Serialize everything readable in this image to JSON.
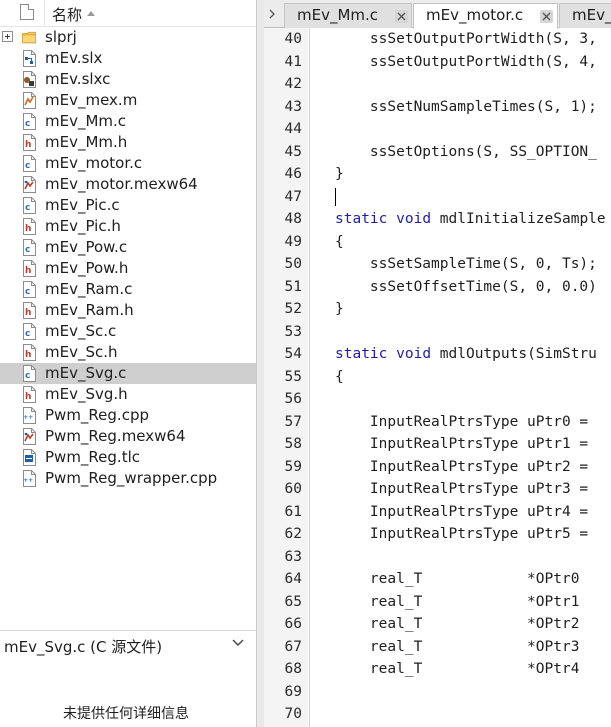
{
  "explorer": {
    "column_name": "名称",
    "files": [
      {
        "name": "slprj",
        "icon": "folder-icon",
        "expandable": true
      },
      {
        "name": "mEv.slx",
        "icon": "simulink-model-icon"
      },
      {
        "name": "mEv.slxc",
        "icon": "simulink-cache-icon"
      },
      {
        "name": "mEv_mex.m",
        "icon": "matlab-script-icon"
      },
      {
        "name": "mEv_Mm.c",
        "icon": "c-file-icon"
      },
      {
        "name": "mEv_Mm.h",
        "icon": "h-file-icon"
      },
      {
        "name": "mEv_motor.c",
        "icon": "c-file-icon"
      },
      {
        "name": "mEv_motor.mexw64",
        "icon": "mex-file-icon"
      },
      {
        "name": "mEv_Pic.c",
        "icon": "c-file-icon"
      },
      {
        "name": "mEv_Pic.h",
        "icon": "h-file-icon"
      },
      {
        "name": "mEv_Pow.c",
        "icon": "c-file-icon"
      },
      {
        "name": "mEv_Pow.h",
        "icon": "h-file-icon"
      },
      {
        "name": "mEv_Ram.c",
        "icon": "c-file-icon"
      },
      {
        "name": "mEv_Ram.h",
        "icon": "h-file-icon"
      },
      {
        "name": "mEv_Sc.c",
        "icon": "c-file-icon"
      },
      {
        "name": "mEv_Sc.h",
        "icon": "h-file-icon"
      },
      {
        "name": "mEv_Svg.c",
        "icon": "c-file-icon",
        "selected": true
      },
      {
        "name": "mEv_Svg.h",
        "icon": "h-file-icon"
      },
      {
        "name": "Pwm_Reg.cpp",
        "icon": "cpp-file-icon"
      },
      {
        "name": "Pwm_Reg.mexw64",
        "icon": "mex-file-icon"
      },
      {
        "name": "Pwm_Reg.tlc",
        "icon": "tlc-file-icon"
      },
      {
        "name": "Pwm_Reg_wrapper.cpp",
        "icon": "cpp-file-icon"
      }
    ]
  },
  "details": {
    "title": "mEv_Svg.c  (C 源文件)",
    "message": "未提供任何详细信息"
  },
  "tabs": [
    {
      "label": "mEv_Mm.c",
      "active": false
    },
    {
      "label": "mEv_motor.c",
      "active": true
    },
    {
      "label": "mEv_S",
      "active": false
    }
  ],
  "code": {
    "lines": [
      {
        "n": "40",
        "text": "    ssSetOutputPortWidth(S, 3,"
      },
      {
        "n": "41",
        "text": "    ssSetOutputPortWidth(S, 4,"
      },
      {
        "n": "42",
        "text": ""
      },
      {
        "n": "43",
        "text": "    ssSetNumSampleTimes(S, 1);"
      },
      {
        "n": "44",
        "text": ""
      },
      {
        "n": "45",
        "text": "    ssSetOptions(S, SS_OPTION_"
      },
      {
        "n": "46",
        "text": "}"
      },
      {
        "n": "47",
        "text": ""
      },
      {
        "n": "48",
        "text": "static void mdlInitializeSample"
      },
      {
        "n": "49",
        "text": "{"
      },
      {
        "n": "50",
        "text": "    ssSetSampleTime(S, 0, Ts);"
      },
      {
        "n": "51",
        "text": "    ssSetOffsetTime(S, 0, 0.0)"
      },
      {
        "n": "52",
        "text": "}"
      },
      {
        "n": "53",
        "text": ""
      },
      {
        "n": "54",
        "text": "static void mdlOutputs(SimStru"
      },
      {
        "n": "55",
        "text": "{"
      },
      {
        "n": "56",
        "text": ""
      },
      {
        "n": "57",
        "text": "    InputRealPtrsType uPtr0 ="
      },
      {
        "n": "58",
        "text": "    InputRealPtrsType uPtr1 ="
      },
      {
        "n": "59",
        "text": "    InputRealPtrsType uPtr2 ="
      },
      {
        "n": "60",
        "text": "    InputRealPtrsType uPtr3 ="
      },
      {
        "n": "61",
        "text": "    InputRealPtrsType uPtr4 ="
      },
      {
        "n": "62",
        "text": "    InputRealPtrsType uPtr5 ="
      },
      {
        "n": "63",
        "text": ""
      },
      {
        "n": "64",
        "text": "    real_T            *OPtr0"
      },
      {
        "n": "65",
        "text": "    real_T            *OPtr1"
      },
      {
        "n": "66",
        "text": "    real_T            *OPtr2"
      },
      {
        "n": "67",
        "text": "    real_T            *OPtr3"
      },
      {
        "n": "68",
        "text": "    real_T            *OPtr4"
      },
      {
        "n": "69",
        "text": ""
      },
      {
        "n": "70",
        "text": ""
      }
    ]
  },
  "colors": {
    "selection": "#cfcfcf",
    "keyword": "#1e1ea8",
    "c_icon_letter": "#2c6fbe",
    "h_icon_letter": "#c0392b"
  }
}
